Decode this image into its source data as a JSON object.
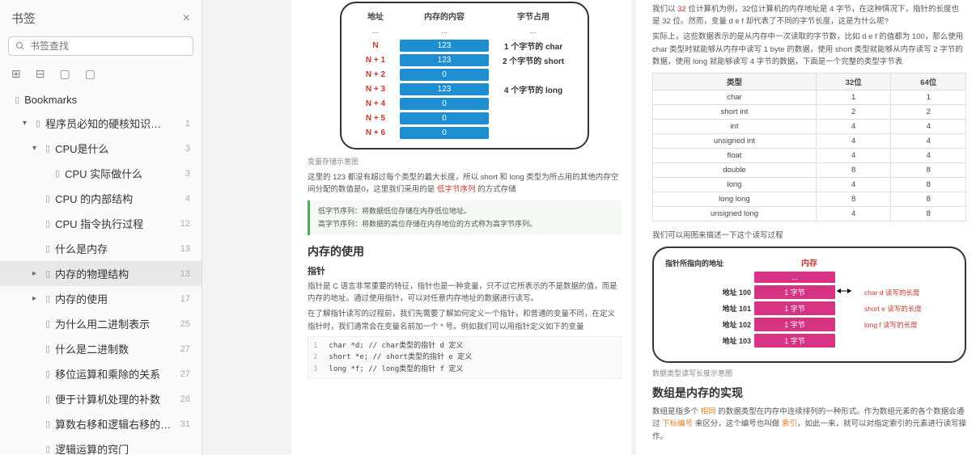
{
  "sidebar": {
    "title": "书签",
    "search_placeholder": "书签查找",
    "root_label": "Bookmarks",
    "doc_title": "程序员必知的硬核知识大全",
    "doc_page": "1",
    "items": [
      {
        "label": "CPU是什么",
        "page": "3",
        "indent": 2,
        "tw": "▾"
      },
      {
        "label": "CPU 实际做什么",
        "page": "3",
        "indent": 3,
        "tw": ""
      },
      {
        "label": "CPU 的内部结构",
        "page": "4",
        "indent": 2,
        "tw": ""
      },
      {
        "label": "CPU 指令执行过程",
        "page": "12",
        "indent": 2,
        "tw": ""
      },
      {
        "label": "什么是内存",
        "page": "13",
        "indent": 2,
        "tw": ""
      },
      {
        "label": "内存的物理结构",
        "page": "13",
        "indent": 2,
        "tw": "▸",
        "active": true
      },
      {
        "label": "内存的使用",
        "page": "17",
        "indent": 2,
        "tw": "▸"
      },
      {
        "label": "为什么用二进制表示",
        "page": "25",
        "indent": 2,
        "tw": ""
      },
      {
        "label": "什么是二进制数",
        "page": "27",
        "indent": 2,
        "tw": ""
      },
      {
        "label": "移位运算和乘除的关系",
        "page": "27",
        "indent": 2,
        "tw": ""
      },
      {
        "label": "便于计算机处理的补数",
        "page": "28",
        "indent": 2,
        "tw": ""
      },
      {
        "label": "算数右移和逻辑右移的区别",
        "page": "31",
        "indent": 2,
        "tw": ""
      },
      {
        "label": "逻辑运算的窍门",
        "page": "",
        "indent": 2,
        "tw": ""
      }
    ]
  },
  "left_page": {
    "mem_table": {
      "headers": [
        "地址",
        "内存的内容",
        "字节占用"
      ],
      "rows": [
        {
          "addr": "...",
          "val": "...",
          "note": "...",
          "dots": true
        },
        {
          "addr": "N",
          "val": "123",
          "note": "1 个字节的 char"
        },
        {
          "addr": "N + 1",
          "val": "123",
          "note": "2 个字节的 short"
        },
        {
          "addr": "N + 2",
          "val": "0",
          "note": ""
        },
        {
          "addr": "N + 3",
          "val": "123",
          "note": "4 个字节的 long"
        },
        {
          "addr": "N + 4",
          "val": "0",
          "note": ""
        },
        {
          "addr": "N + 5",
          "val": "0",
          "note": ""
        },
        {
          "addr": "N + 6",
          "val": "0",
          "note": ""
        }
      ]
    },
    "cap1": "变量存储示意图",
    "para1_a": "这里的 123 都没有超过每个类型的最大长度，所以 short 和 long 类型为所占用的其他内存空间分配的数值是0，这里我们采用的是 ",
    "para1_b": "低字节序列",
    "para1_c": " 的方式存储",
    "tip1": "低字节序列：将数据低位存储在内存低位地址。",
    "tip2": "高字节序列：将数据的高位存储在内存地位的方式称为高字节序列。",
    "h2": "内存的使用",
    "h3": "指针",
    "para2": "指针是 C 语言非常重要的特征，指针也是一种变量，只不过它所表示的不是数据的值，而是内存的地址。通过使用指针，可以对任意内存地址的数据进行读写。",
    "para3": "在了解指针读写的过程前，我们先需要了解如何定义一个指针，和普通的变量不同，在定义指针时，我们通常会在变量名前加一个 * 号。例如我们可以用指针定义如下的变量",
    "code": [
      {
        "ln": "1",
        "text": "char *d; // char类型的指针 d 定义"
      },
      {
        "ln": "2",
        "text": "short *e; // short类型的指针 e 定义"
      },
      {
        "ln": "3",
        "text": "long *f; // long类型的指针 f 定义"
      }
    ]
  },
  "right_page": {
    "para1_a": "我们以 ",
    "para1_b": "32",
    "para1_c": " 位计算机为例，32位计算机的内存地址是 4 字节，在这种情况下，指针的长度也是 32 位。然而，变量 d e f 却代表了不同的字节长度，这是为什么呢?",
    "para2": "实际上，这些数据表示的是从内存中一次读取的字节数，比如 d e f 的值都为 100，那么使用 char 类型时就能够从内存中读写 1 byte 的数据，使用 short 类型就能够从内存读写 2 字节的数据，使用 long 就能够读写 4 字节的数据，下面是一个完整的类型字节表",
    "type_table": {
      "headers": [
        "类型",
        "32位",
        "64位"
      ],
      "rows": [
        [
          "char",
          "1",
          "1"
        ],
        [
          "short int",
          "2",
          "2"
        ],
        [
          "int",
          "4",
          "4"
        ],
        [
          "unsigned int",
          "4",
          "4"
        ],
        [
          "float",
          "4",
          "4"
        ],
        [
          "double",
          "8",
          "8"
        ],
        [
          "long",
          "4",
          "8"
        ],
        [
          "long long",
          "8",
          "8"
        ],
        [
          "unsigned long",
          "4",
          "8"
        ]
      ]
    },
    "para3": "我们可以用图来描述一下这个读写过程",
    "mem2": {
      "title": "内存",
      "ptr_label": "指针所指向的地址",
      "rows": [
        {
          "addr": "...",
          "cell": "...",
          "note": "",
          "dots": true
        },
        {
          "addr": "地址 100",
          "cell": "1 字节",
          "note": "char d 读写的长度"
        },
        {
          "addr": "地址 101",
          "cell": "1 字节",
          "note": "short e 读写的长度"
        },
        {
          "addr": "地址 102",
          "cell": "1 字节",
          "note": "long f 读写的长度"
        },
        {
          "addr": "地址 103",
          "cell": "1 字节",
          "note": ""
        }
      ]
    },
    "cap2": "数据类型读写长度示意图",
    "h2": "数组是内存的实现",
    "para4_a": "数组是指多个 ",
    "para4_b": "相同",
    "para4_c": " 的数据类型在内存中连续排列的一种形式。作为数组元素的各个数据会通过 ",
    "para4_d": "下标编号",
    "para4_e": " 来区分，这个编号也叫做 ",
    "para4_f": "索引",
    "para4_g": "，如此一来，就可以对指定索引的元素进行读写操作。"
  }
}
